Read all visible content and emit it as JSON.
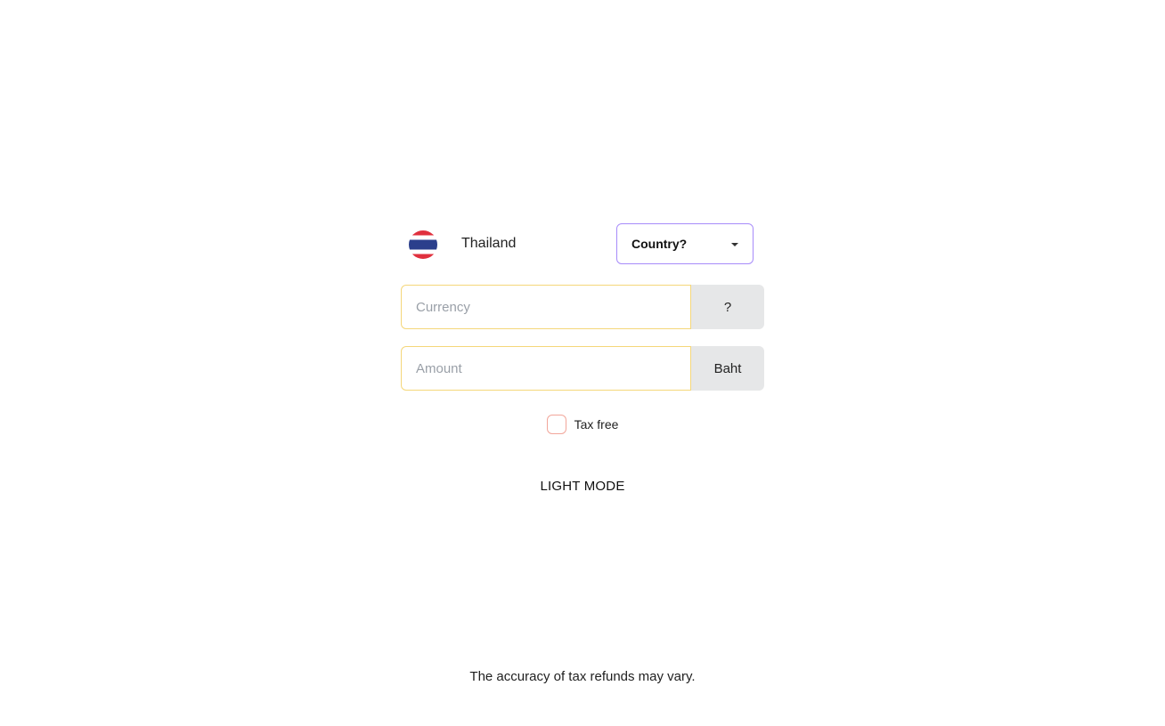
{
  "country": {
    "flag_icon": "thailand-flag-icon",
    "name": "Thailand",
    "select_label": "Country?",
    "select_icon": "caret-down-icon"
  },
  "currency_field": {
    "placeholder": "Currency",
    "value": "",
    "addon": "?"
  },
  "amount_field": {
    "placeholder": "Amount",
    "value": "",
    "addon": "Baht"
  },
  "tax_free": {
    "label": "Tax free",
    "checked": false
  },
  "mode_toggle": {
    "label": "LIGHT MODE"
  },
  "footer": {
    "disclaimer": "The accuracy of tax refunds may vary."
  },
  "colors": {
    "select_border": "#a78bfa",
    "input_border": "#f5d77a",
    "addon_background": "#e6e7e8",
    "checkbox_border": "#f2a69a"
  }
}
